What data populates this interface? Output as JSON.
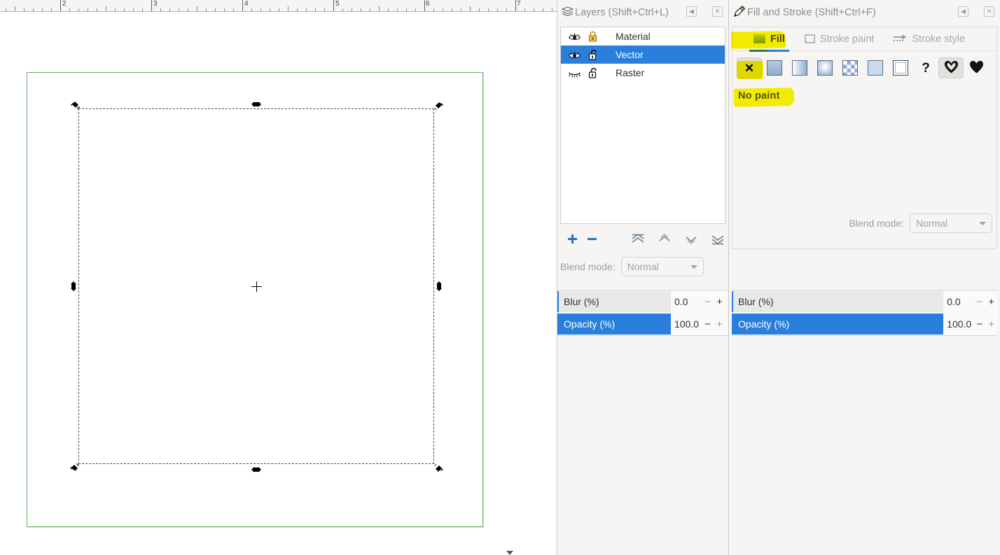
{
  "canvas": {
    "ruler": {
      "labels": [
        "2",
        "3",
        "4",
        "5",
        "6",
        "7"
      ],
      "unit_positions": [
        86,
        216,
        346,
        476,
        605,
        735
      ],
      "cursor_marker": "ruler-cursor-triangle"
    },
    "page": {
      "border_color": "#6aab6a",
      "fill_color": "#ffffff"
    },
    "selection": {
      "handle_count": 8,
      "center_marker": "rotation-center-cross",
      "style": "dashed"
    }
  },
  "layers_panel": {
    "title": "Layers (Shift+Ctrl+L)",
    "icon": "layers-stack-icon",
    "titlebar_buttons": [
      {
        "name": "collapse-button",
        "glyph": "◀"
      },
      {
        "name": "close-button",
        "glyph": "✕"
      }
    ],
    "layers": [
      {
        "name": "Material",
        "visible": true,
        "locked": true
      },
      {
        "name": "Vector",
        "visible": true,
        "locked": false,
        "selected": true
      },
      {
        "name": "Raster",
        "visible": false,
        "locked": false
      }
    ],
    "tools": [
      {
        "name": "add-layer-button",
        "glyph": "＋"
      },
      {
        "name": "remove-layer-button",
        "glyph": "−"
      },
      {
        "name": "raise-to-top-button",
        "glyph": "raise-top-icon"
      },
      {
        "name": "raise-layer-button",
        "glyph": "raise-icon"
      },
      {
        "name": "lower-layer-button",
        "glyph": "lower-icon"
      },
      {
        "name": "lower-to-bottom-button",
        "glyph": "lower-bottom-icon"
      }
    ],
    "blend": {
      "label": "Blend mode:",
      "value": "Normal"
    },
    "sliders": [
      {
        "label": "Blur (%)",
        "value": "0.0",
        "fill_pct": 0,
        "minus_enabled": false,
        "plus_enabled": true
      },
      {
        "label": "Opacity (%)",
        "value": "100.0",
        "fill_pct": 100,
        "minus_enabled": true,
        "plus_enabled": false
      }
    ]
  },
  "fill_stroke_panel": {
    "title": "Fill and Stroke (Shift+Ctrl+F)",
    "icon": "fill-stroke-pen-icon",
    "titlebar_buttons": [
      {
        "name": "collapse-button",
        "glyph": "◀"
      },
      {
        "name": "close-button",
        "glyph": "✕"
      }
    ],
    "tabs": [
      {
        "label": "Fill",
        "active": true,
        "icon": "fill-swatch-icon"
      },
      {
        "label": "Stroke paint",
        "active": false,
        "icon": "stroke-square-icon"
      },
      {
        "label": "Stroke style",
        "active": false,
        "icon": "stroke-style-icon"
      }
    ],
    "paint_types": [
      {
        "name": "no-paint-button",
        "glyph": "✕",
        "selected": true
      },
      {
        "name": "flat-color-button",
        "glyph": "flat-swatch"
      },
      {
        "name": "linear-gradient-button",
        "glyph": "linear-swatch"
      },
      {
        "name": "radial-gradient-button",
        "glyph": "radial-swatch"
      },
      {
        "name": "pattern-button",
        "glyph": "pattern-swatch"
      },
      {
        "name": "mesh-gradient-button",
        "glyph": "mesh-swatch"
      },
      {
        "name": "swatch-button",
        "glyph": "swatch-swatch"
      },
      {
        "name": "unknown-paint-button",
        "glyph": "?"
      },
      {
        "name": "fill-rule-evenodd-button",
        "glyph": "heart-hole",
        "selected": true
      },
      {
        "name": "fill-rule-nonzero-button",
        "glyph": "heart-solid"
      }
    ],
    "blend": {
      "label": "Blend mode:",
      "value": "Normal"
    },
    "sliders": [
      {
        "label": "Blur (%)",
        "value": "0.0",
        "fill_pct": 0,
        "minus_enabled": false,
        "plus_enabled": true
      },
      {
        "label": "Opacity (%)",
        "value": "100.0",
        "fill_pct": 100,
        "minus_enabled": true,
        "plus_enabled": false
      }
    ]
  },
  "annotations": {
    "no_paint_label": "No paint",
    "highlight_color": "#fbf500",
    "highlighted_targets": [
      "Fill tab",
      "no-paint-button",
      "No paint label"
    ]
  },
  "colors": {
    "selection_blue": "#2a7fdd",
    "page_border_green": "#6aab6a",
    "panel_bg": "#f6f5f4",
    "highlight_yellow": "#fbf500"
  }
}
